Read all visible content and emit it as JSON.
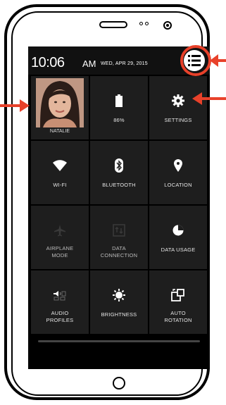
{
  "statusbar": {
    "time": "10:06",
    "ampm": "AM",
    "date": "WED, APR 29, 2015"
  },
  "tiles": [
    {
      "label": "NATALIE",
      "icon": "avatar-photo"
    },
    {
      "label": "86%",
      "icon": "battery-icon",
      "battery_level_percent": 86
    },
    {
      "label": "SETTINGS",
      "icon": "gear-icon"
    },
    {
      "label": "WI-FI",
      "icon": "wifi-icon"
    },
    {
      "label": "BLUETOOTH",
      "icon": "bluetooth-icon"
    },
    {
      "label": "LOCATION",
      "icon": "location-pin-icon"
    },
    {
      "label": "AIRPLANE MODE",
      "icon": "airplane-icon"
    },
    {
      "label": "DATA CONNECTION",
      "icon": "data-connection-icon"
    },
    {
      "label": "DATA USAGE",
      "icon": "data-usage-icon"
    },
    {
      "label": "AUDIO PROFILES",
      "icon": "audio-profiles-icon"
    },
    {
      "label": "BRIGHTNESS",
      "icon": "brightness-icon"
    },
    {
      "label": "AUTO ROTATION",
      "icon": "auto-rotation-icon"
    }
  ],
  "colors": {
    "screen_bg": "#000000",
    "tile_bg": "#1e1e1e",
    "annotation": "#e8412a",
    "highlight_ring": "#e8412a"
  }
}
